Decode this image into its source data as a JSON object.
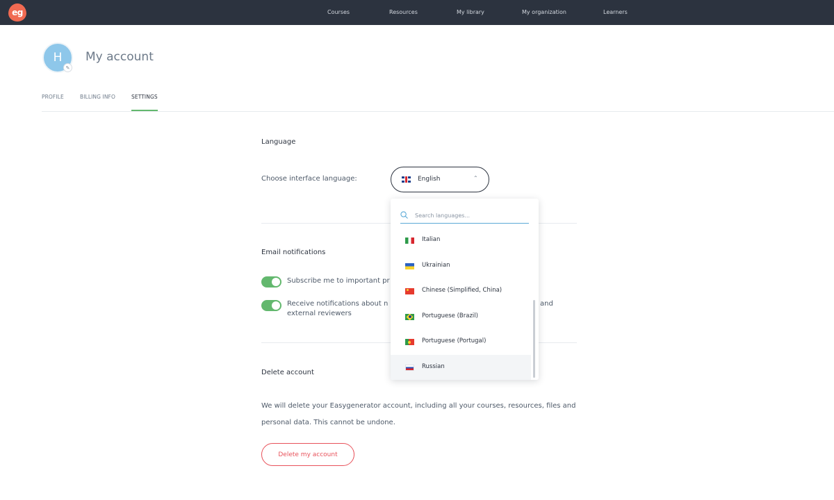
{
  "app": {
    "logo_text": "eg"
  },
  "nav": {
    "items": [
      {
        "label": "Courses"
      },
      {
        "label": "Resources"
      },
      {
        "label": "My library"
      },
      {
        "label": "My organization"
      },
      {
        "label": "Learners"
      }
    ]
  },
  "header": {
    "avatar_initial": "H",
    "avatar_edit_icon": "pencil-icon",
    "title": "My account"
  },
  "tabs": [
    {
      "label": "PROFILE",
      "active": false
    },
    {
      "label": "BILLING INFO",
      "active": false
    },
    {
      "label": "SETTINGS",
      "active": true
    }
  ],
  "language": {
    "section_title": "Language",
    "choose_label": "Choose interface language:",
    "selected": {
      "label": "English",
      "flag": "flag-uk-icon"
    },
    "search_placeholder": "Search languages...",
    "options": [
      {
        "label": "Italian",
        "flag": "flag-italy-icon"
      },
      {
        "label": "Ukrainian",
        "flag": "flag-ukraine-icon"
      },
      {
        "label": "Chinese (Simplified, China)",
        "flag": "flag-china-icon"
      },
      {
        "label": "Portuguese (Brazil)",
        "flag": "flag-brazil-icon"
      },
      {
        "label": "Portuguese (Portugal)",
        "flag": "flag-portugal-icon"
      },
      {
        "label": "Russian",
        "flag": "flag-russia-icon",
        "hovered": true
      }
    ]
  },
  "email": {
    "section_title": "Email notifications",
    "toggles": [
      {
        "text_before": "Subscribe me to important pr",
        "on": true
      },
      {
        "text_before": "Receive notifications about n",
        "text_after": "and",
        "line2": "external reviewers",
        "on": true
      }
    ]
  },
  "delete": {
    "section_title": "Delete account",
    "description": "We will delete your Easygenerator account, including all your courses, resources, files and personal data. This cannot be undone.",
    "button_label": "Delete my account"
  },
  "colors": {
    "topbar": "#2c333f",
    "accent_green": "#63b86e",
    "danger_red": "#e8515a",
    "search_underline": "#5aa9d6",
    "logo": "#f06a52"
  }
}
